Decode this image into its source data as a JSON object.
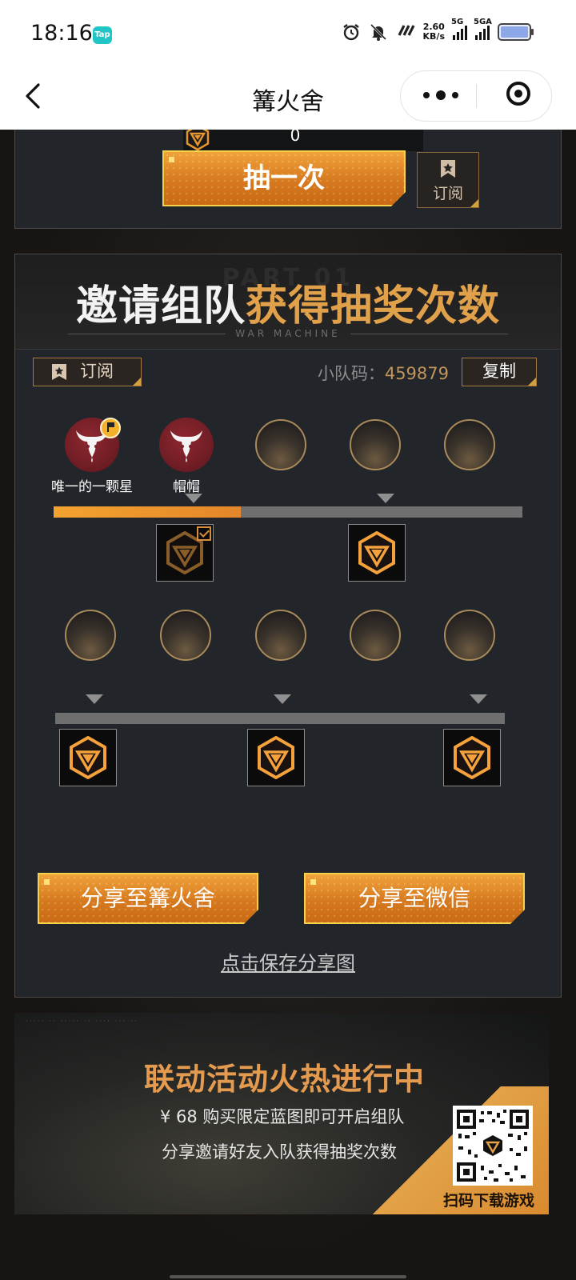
{
  "status_bar": {
    "time": "18:16",
    "app_badge": "Tap",
    "net_speed_value": "2.60",
    "net_speed_unit": "KB/s",
    "signal1_label": "5G",
    "signal2_label": "5GA",
    "icons": [
      "alarm-icon",
      "mute-icon",
      "network-brand-icon",
      "battery-icon"
    ]
  },
  "nav": {
    "title": "篝火舍",
    "back_icon": "chevron-left-icon",
    "more_icon": "more-dots-icon",
    "close_icon": "target-icon"
  },
  "draw_section": {
    "counter_value": "0",
    "draw_button": "抽一次",
    "subscribe_label": "订阅"
  },
  "invite_section": {
    "title_white": "邀请组队",
    "title_gold": "获得抽奖次数",
    "watermark": "PART 01",
    "subtitle": "WAR MACHINE",
    "subscribe_label": "订阅",
    "team_code_label": "小队码：",
    "team_code_value": "459879",
    "copy_button": "复制",
    "members": [
      {
        "name": "唯一的一颗星",
        "filled": true,
        "leader": true
      },
      {
        "name": "帽帽",
        "filled": true,
        "leader": false
      },
      {
        "name": "",
        "filled": false,
        "leader": false
      },
      {
        "name": "",
        "filled": false,
        "leader": false
      },
      {
        "name": "",
        "filled": false,
        "leader": false
      },
      {
        "name": "",
        "filled": false,
        "leader": false
      },
      {
        "name": "",
        "filled": false,
        "leader": false
      },
      {
        "name": "",
        "filled": false,
        "leader": false
      },
      {
        "name": "",
        "filled": false,
        "leader": false
      },
      {
        "name": "",
        "filled": false,
        "leader": false
      }
    ],
    "progress_row1_fraction": 0.4,
    "progress_row2_fraction": 0.0,
    "rewards_row1": [
      {
        "claimed": true
      },
      {
        "claimed": false
      }
    ],
    "rewards_row2": [
      {
        "claimed": false
      },
      {
        "claimed": false
      },
      {
        "claimed": false
      }
    ],
    "share_feed_button": "分享至篝火舍",
    "share_wechat_button": "分享至微信",
    "save_image_link": "点击保存分享图"
  },
  "promo": {
    "headline": "联动活动火热进行中",
    "line1": "¥ 68 购买限定蓝图即可开启组队",
    "line2": "分享邀请好友入队获得抽奖次数",
    "qr_label": "扫码下载游戏"
  },
  "colors": {
    "accent_gold": "#e0a14a",
    "button_orange": "#d6791f",
    "panel_bg": "#22252a",
    "avatar_red": "#7a1f27"
  }
}
